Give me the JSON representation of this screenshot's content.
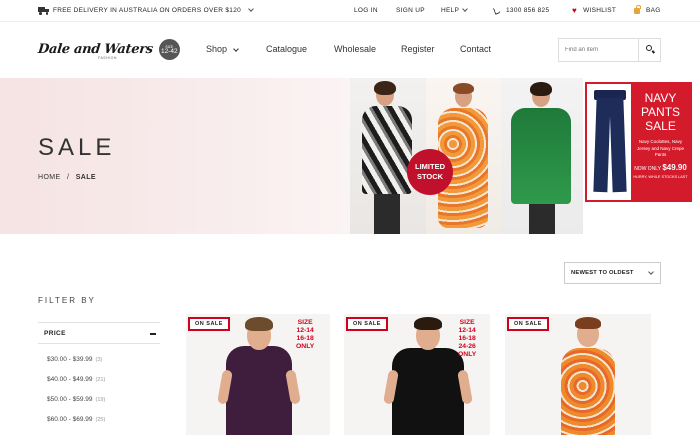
{
  "topbar": {
    "delivery": "FREE DELIVERY IN AUSTRALIA ON ORDERS OVER $120",
    "login": "LOG IN",
    "signup": "SIGN UP",
    "help": "HELP",
    "phone": "1300 856 825",
    "wishlist": "WISHLIST",
    "bag": "BAG"
  },
  "header": {
    "logo_text": "Dale and Waters",
    "logo_sub": "FASHION",
    "logo_badge_top": "SIZE",
    "logo_badge": "12-42",
    "nav": {
      "shop": "Shop",
      "catalogue": "Catalogue",
      "wholesale": "Wholesale",
      "register": "Register",
      "contact": "Contact"
    },
    "search_placeholder": "Find an item"
  },
  "banner": {
    "title": "SALE",
    "breadcrumb_home": "HOME",
    "breadcrumb_sep": "/",
    "breadcrumb_current": "SALE",
    "limited_line1": "LIMITED",
    "limited_line2": "STOCK",
    "navy_title_1": "NAVY",
    "navy_title_2": "PANTS",
    "navy_title_3": "SALE",
    "navy_desc": "Navy Coolottes, Navy Jersey and Navy Crepe Pants",
    "navy_price_prefix": "NOW ONLY",
    "navy_price": "$49.90",
    "navy_hurry": "HURRY, WHILE STOCKS LAST"
  },
  "sort": {
    "selected": "NEWEST TO OLDEST"
  },
  "filter": {
    "title": "FILTER BY",
    "price_label": "PRICE",
    "prices": [
      {
        "range": "$30.00 - $39.99",
        "count": "(3)"
      },
      {
        "range": "$40.00 - $49.99",
        "count": "(21)"
      },
      {
        "range": "$50.00 - $59.99",
        "count": "(19)"
      },
      {
        "range": "$60.00 - $69.99",
        "count": "(25)"
      }
    ]
  },
  "products": [
    {
      "badge": "ON SALE",
      "size_lines": [
        "SIZE",
        "12-14",
        "16-18",
        "ONLY"
      ],
      "color": "#3f1d3d"
    },
    {
      "badge": "ON SALE",
      "size_lines": [
        "SIZE",
        "12-14",
        "16-18",
        "24-26",
        "ONLY"
      ],
      "color": "#111111"
    },
    {
      "badge": "ON SALE",
      "size_lines": [],
      "color": "#ef8a2a"
    }
  ],
  "colors": {
    "accent_red": "#d0021b",
    "banner_pink": "#f6e3e3",
    "navy_red": "#d41b2c"
  }
}
